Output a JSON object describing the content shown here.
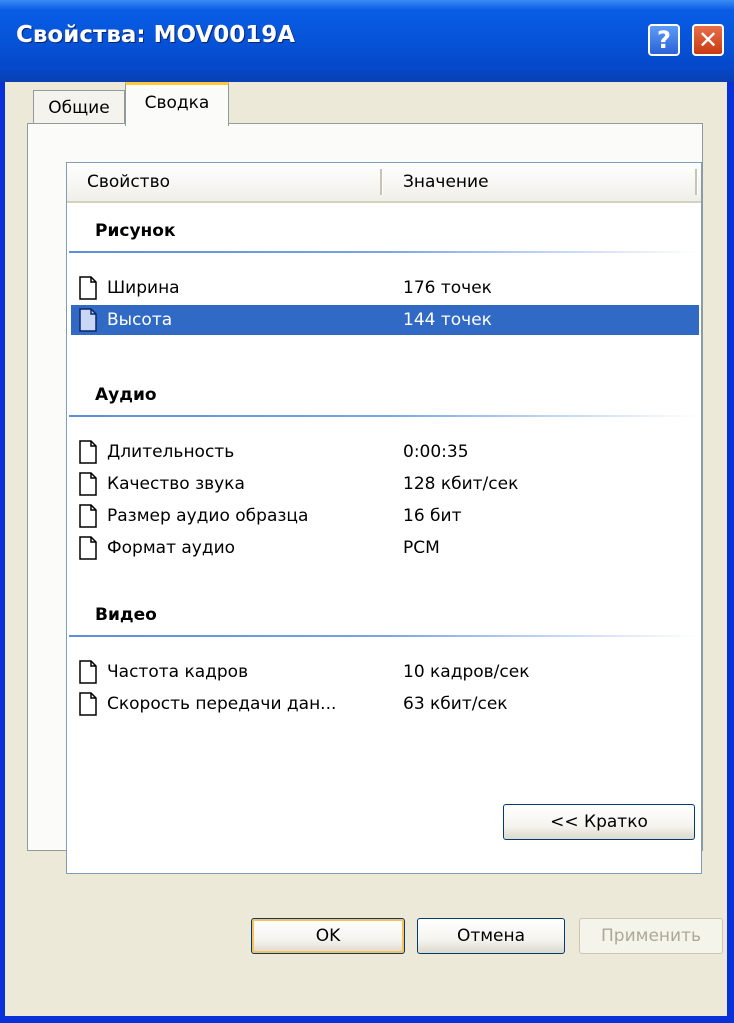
{
  "window": {
    "title": "Свойства: MOV0019A",
    "help_label": "?",
    "close_label": "✕"
  },
  "tabs": [
    {
      "label": "Общие",
      "active": false
    },
    {
      "label": "Сводка",
      "active": true
    }
  ],
  "columns": {
    "property": "Свойство",
    "value": "Значение"
  },
  "groups": [
    {
      "title": "Рисунок",
      "rows": [
        {
          "name": "Ширина",
          "value": "176 точек",
          "selected": false
        },
        {
          "name": "Высота",
          "value": "144 точек",
          "selected": true
        }
      ]
    },
    {
      "title": "Аудио",
      "rows": [
        {
          "name": "Длительность",
          "value": "0:00:35",
          "selected": false
        },
        {
          "name": "Качество звука",
          "value": "128 кбит/сек",
          "selected": false
        },
        {
          "name": "Размер аудио образца",
          "value": "16 бит",
          "selected": false
        },
        {
          "name": "Формат аудио",
          "value": "PCM",
          "selected": false
        }
      ]
    },
    {
      "title": "Видео",
      "rows": [
        {
          "name": "Частота кадров",
          "value": "10 кадров/сек",
          "selected": false
        },
        {
          "name": "Скорость передачи дан...",
          "value": "63 кбит/сек",
          "selected": false
        }
      ]
    }
  ],
  "buttons": {
    "brief": "<< Кратко",
    "ok": "OK",
    "cancel": "Отмена",
    "apply": "Применить"
  },
  "icons": {
    "row_icon": "document-icon",
    "selection_color": "#316ac5",
    "title_color": "#0653d8"
  }
}
